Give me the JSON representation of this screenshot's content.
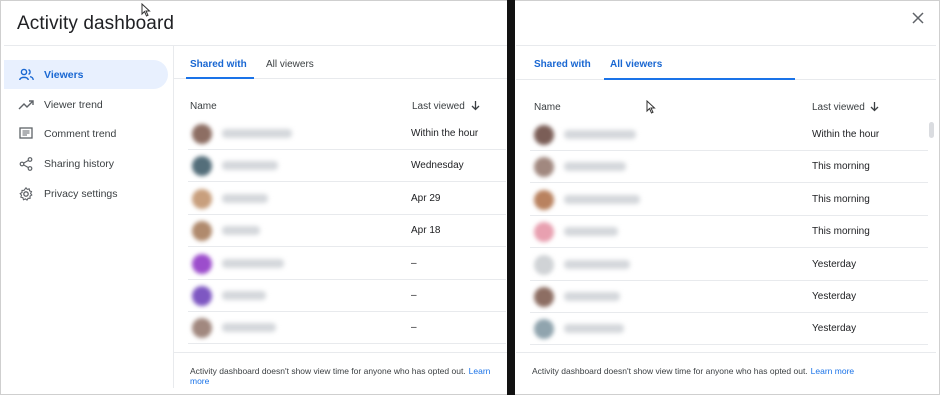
{
  "left": {
    "title": "Activity dashboard",
    "nav": [
      {
        "label": "Viewers",
        "icon": "people-icon",
        "active": true
      },
      {
        "label": "Viewer trend",
        "icon": "trend-icon",
        "active": false
      },
      {
        "label": "Comment trend",
        "icon": "comment-icon",
        "active": false
      },
      {
        "label": "Sharing history",
        "icon": "share-icon",
        "active": false
      },
      {
        "label": "Privacy settings",
        "icon": "gear-icon",
        "active": false
      }
    ],
    "tabs": [
      "Shared with",
      "All viewers"
    ],
    "active_tab": 0,
    "col_name": "Name",
    "col_last": "Last viewed",
    "rows": [
      {
        "when": "Within the hour",
        "avatar": "#8d6e63"
      },
      {
        "when": "Wednesday",
        "avatar": "#546e7a"
      },
      {
        "when": "Apr 29",
        "avatar": "#c89f7d"
      },
      {
        "when": "Apr 18",
        "avatar": "#b08a6d"
      },
      {
        "when": "–",
        "avatar": "#9c4dcc"
      },
      {
        "when": "–",
        "avatar": "#7e57c2"
      },
      {
        "when": "–",
        "avatar": "#a1887f"
      }
    ],
    "footer_text": "Activity dashboard doesn't show view time for anyone who has opted out.",
    "footer_link": "Learn more"
  },
  "right": {
    "tabs": [
      "Shared with",
      "All viewers"
    ],
    "active_tab": 1,
    "col_name": "Name",
    "col_last": "Last viewed",
    "rows": [
      {
        "when": "Within the hour",
        "avatar": "#7b5e57"
      },
      {
        "when": "This morning",
        "avatar": "#a1887f"
      },
      {
        "when": "This morning",
        "avatar": "#b9825f"
      },
      {
        "when": "This morning",
        "avatar": "#e8a0b0"
      },
      {
        "when": "Yesterday",
        "avatar": "#d0d3d6"
      },
      {
        "when": "Yesterday",
        "avatar": "#8d6e63"
      },
      {
        "when": "Yesterday",
        "avatar": "#90a4ae"
      }
    ],
    "footer_text": "Activity dashboard doesn't show view time for anyone who has opted out.",
    "footer_link": "Learn more",
    "close_icon": "close-icon"
  },
  "colors": {
    "accent": "#1a73e8",
    "active_nav_bg": "#e8f0fe",
    "divider": "#111111"
  }
}
